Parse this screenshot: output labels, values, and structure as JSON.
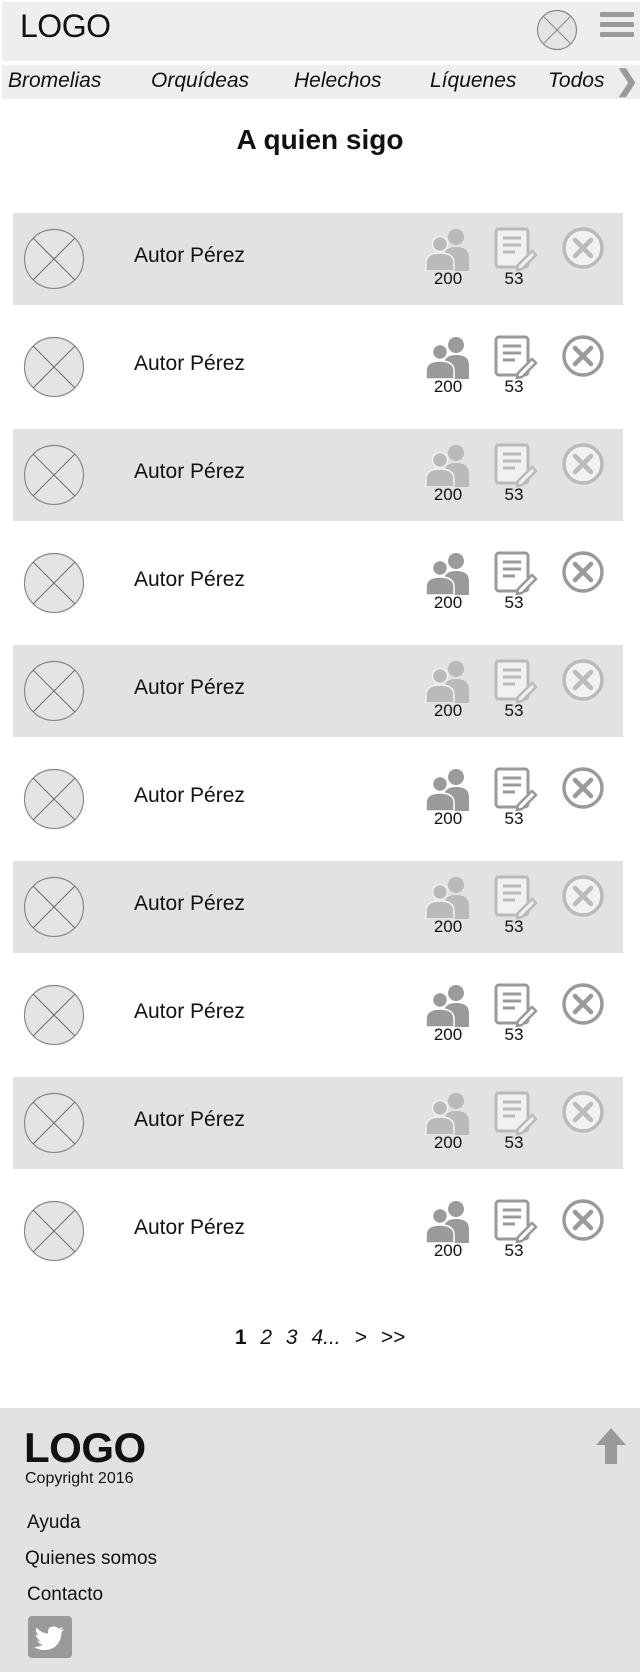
{
  "header": {
    "logo": "LOGO",
    "avatar_icon": "avatar-placeholder-icon",
    "menu_icon": "hamburger-menu-icon"
  },
  "categories": [
    "Bromelias",
    "Orquídeas",
    "Helechos",
    "Líquenes",
    "Todos"
  ],
  "page_title": "A quien sigo",
  "followed_authors": [
    {
      "name": "Autor Pérez",
      "followers": "200",
      "posts": "53"
    },
    {
      "name": "Autor Pérez",
      "followers": "200",
      "posts": "53"
    },
    {
      "name": "Autor Pérez",
      "followers": "200",
      "posts": "53"
    },
    {
      "name": "Autor Pérez",
      "followers": "200",
      "posts": "53"
    },
    {
      "name": "Autor Pérez",
      "followers": "200",
      "posts": "53"
    },
    {
      "name": "Autor Pérez",
      "followers": "200",
      "posts": "53"
    },
    {
      "name": "Autor Pérez",
      "followers": "200",
      "posts": "53"
    },
    {
      "name": "Autor Pérez",
      "followers": "200",
      "posts": "53"
    },
    {
      "name": "Autor Pérez",
      "followers": "200",
      "posts": "53"
    },
    {
      "name": "Autor Pérez",
      "followers": "200",
      "posts": "53"
    }
  ],
  "pagination": {
    "pages": [
      "1",
      "2",
      "3",
      "4"
    ],
    "current": "1",
    "ellipsis": "...",
    "next": ">",
    "last": ">>"
  },
  "footer": {
    "logo": "LOGO",
    "copyright": "Copyright 2016",
    "links": [
      "Ayuda",
      "Quienes somos",
      "Contacto"
    ],
    "social_icon": "twitter-icon",
    "top_icon": "arrow-up-icon"
  },
  "colors": {
    "header_bg": "#eeeeee",
    "row_shade": "#e2e2e2",
    "icon_gray": "#9a9a9a"
  }
}
